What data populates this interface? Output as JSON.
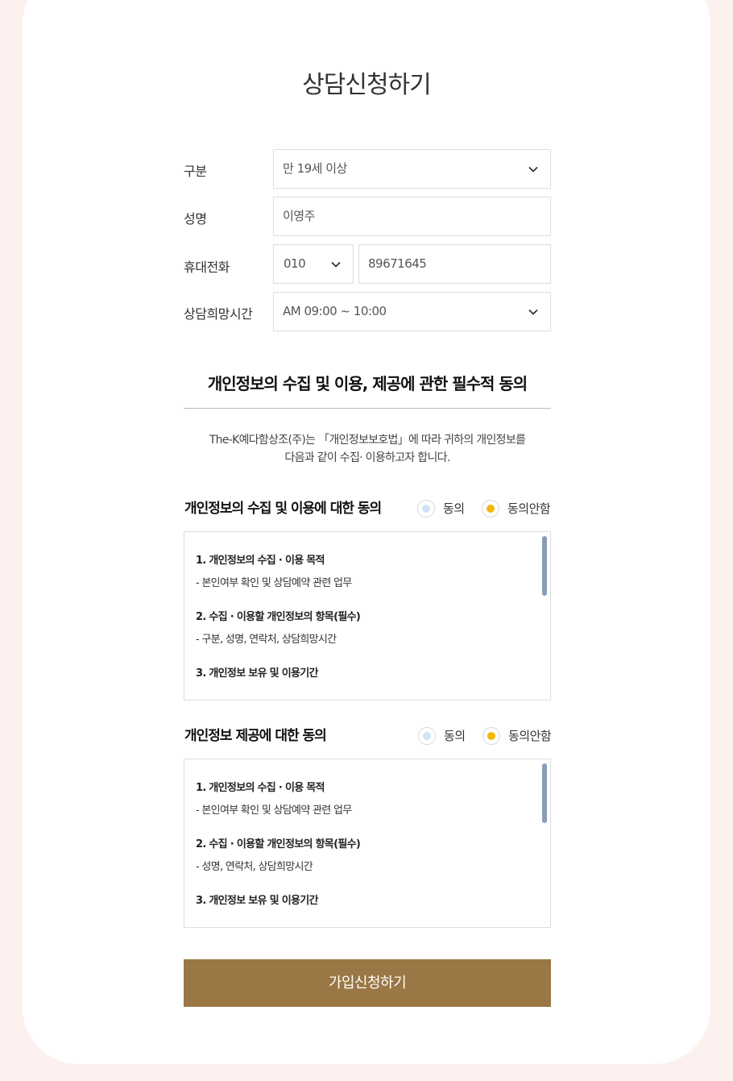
{
  "page_title": "상담신청하기",
  "form": {
    "category": {
      "label": "구분",
      "value": "만 19세 이상"
    },
    "name": {
      "label": "성명",
      "value": "이영주"
    },
    "phone": {
      "label": "휴대전화",
      "prefix": "010",
      "number": "89671645"
    },
    "time": {
      "label": "상담희망시간",
      "value": "AM 09:00 ~ 10:00"
    }
  },
  "agreement": {
    "title": "개인정보의 수집 및 이용, 제공에 관한 필수적 동의",
    "intro_line1": "The-K예다함상조(주)는 「개인정보보호법」에 따라 귀하의 개인정보를",
    "intro_line2": "다음과 같이 수집· 이용하고자 합니다.",
    "sections": [
      {
        "title": "개인정보의 수집 및 이용에 대한 동의",
        "agree_label": "동의",
        "disagree_label": "동의안함",
        "selected": "동의안함",
        "items": [
          {
            "heading": "1. 개인정보의 수집 · 이용 목적",
            "text": "- 본인여부 확인 및 상담예약 관련 업무"
          },
          {
            "heading": "2. 수집 · 이용할 개인정보의 항목(필수)",
            "text": "- 구분, 성명, 연락처, 상담희망시간"
          },
          {
            "heading": "3. 개인정보 보유 및 이용기간",
            "text": ""
          }
        ]
      },
      {
        "title": "개인정보 제공에 대한 동의",
        "agree_label": "동의",
        "disagree_label": "동의안함",
        "selected": "동의안함",
        "items": [
          {
            "heading": "1. 개인정보의 수집 · 이용 목적",
            "text": "- 본인여부 확인 및 상담예약 관련 업무"
          },
          {
            "heading": "2. 수집 · 이용할 개인정보의 항목(필수)",
            "text": "- 성명, 연락처, 상담희망시간"
          },
          {
            "heading": "3. 개인정보 보유 및 이용기간",
            "text": ""
          }
        ]
      }
    ]
  },
  "submit_label": "가입신청하기",
  "colors": {
    "background": "#fdf1f0",
    "accent_button": "#9a7744",
    "radio_selected": "#f2b705",
    "radio_unselected": "#cfe2f7",
    "scrollbar": "#8a9cb8"
  },
  "icons": {
    "select_arrow": "chevron-down-icon"
  }
}
